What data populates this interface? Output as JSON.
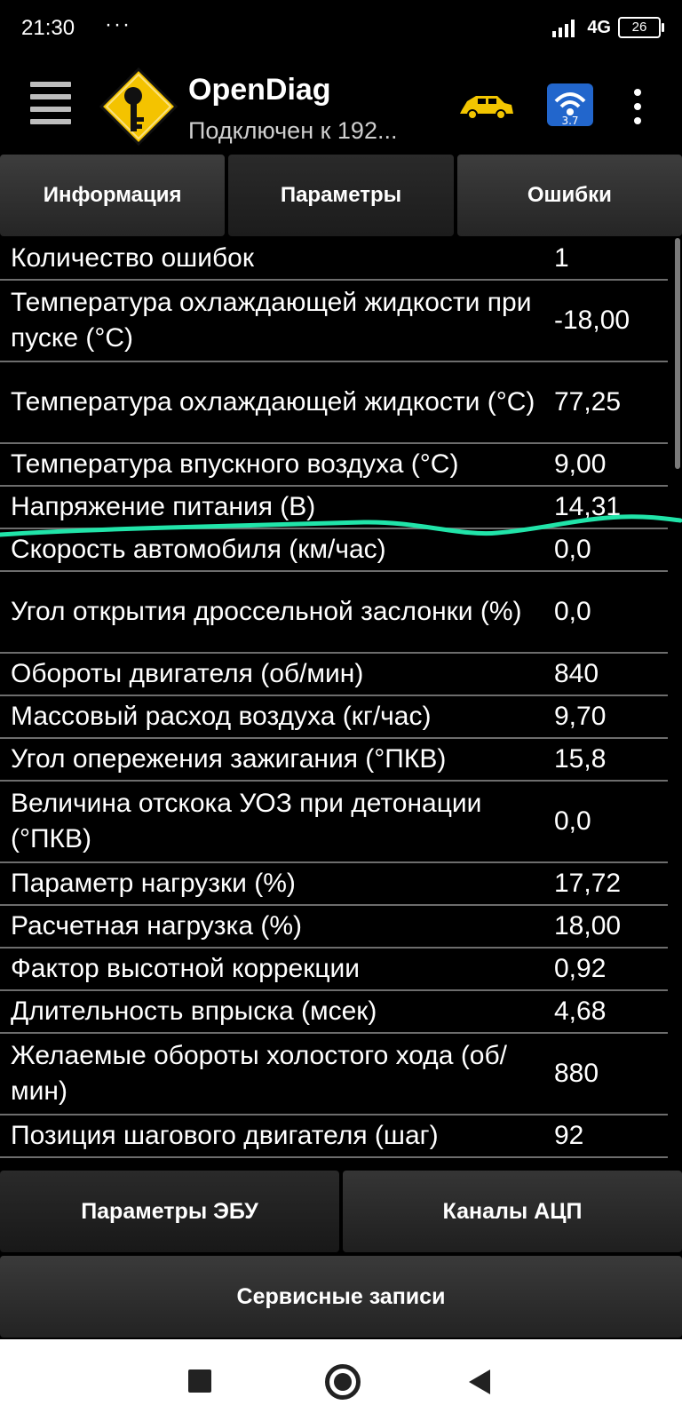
{
  "status_bar": {
    "time": "21:30",
    "dots": "···",
    "network": "4G",
    "battery": "26"
  },
  "app_bar": {
    "title": "OpenDiag",
    "subtitle": "Подключен к 192..."
  },
  "tabs": [
    {
      "label": "Информация",
      "active": false
    },
    {
      "label": "Параметры",
      "active": true
    },
    {
      "label": "Ошибки",
      "active": false
    }
  ],
  "parameters": [
    {
      "name": "Количество ошибок",
      "value": "1"
    },
    {
      "name": "Температура охлаждающей жидкости при пуске (°С)",
      "value": "-18,00"
    },
    {
      "name": "Температура охлаждающей жидкости (°С)",
      "value": "77,25"
    },
    {
      "name": "Температура впускного воздуха (°С)",
      "value": "9,00"
    },
    {
      "name": "Напряжение питания (В)",
      "value": "14,31"
    },
    {
      "name": "Скорость автомобиля (км/час)",
      "value": "0,0"
    },
    {
      "name": "Угол открытия дроссельной заслонки (%)",
      "value": "0,0"
    },
    {
      "name": "Обороты двигателя (об/мин)",
      "value": "840"
    },
    {
      "name": "Массовый расход воздуха (кг/час)",
      "value": "9,70"
    },
    {
      "name": "Угол опережения зажигания (°ПКВ)",
      "value": "15,8"
    },
    {
      "name": "Величина отскока УОЗ при детонации (°ПКВ)",
      "value": "0,0"
    },
    {
      "name": "Параметр нагрузки (%)",
      "value": "17,72"
    },
    {
      "name": "Расчетная нагрузка (%)",
      "value": "18,00"
    },
    {
      "name": "Фактор высотной коррекции",
      "value": "0,92"
    },
    {
      "name": "Длительность впрыска (мсек)",
      "value": "4,68"
    },
    {
      "name": "Желаемые обороты холостого хода (об/мин)",
      "value": "880"
    },
    {
      "name": "Позиция шагового двигателя (шаг)",
      "value": "92"
    }
  ],
  "bottom_buttons": [
    {
      "label": "Параметры ЭБУ",
      "active": true
    },
    {
      "label": "Каналы АЦП",
      "active": false
    }
  ],
  "service_button": {
    "label": "Сервисные записи"
  },
  "colors": {
    "background": "#000000",
    "text": "#ffffff",
    "divider": "#6d6d6d",
    "annotation": "#21e4a9",
    "logo_yellow": "#f4c300",
    "car_yellow": "#f2c500"
  }
}
